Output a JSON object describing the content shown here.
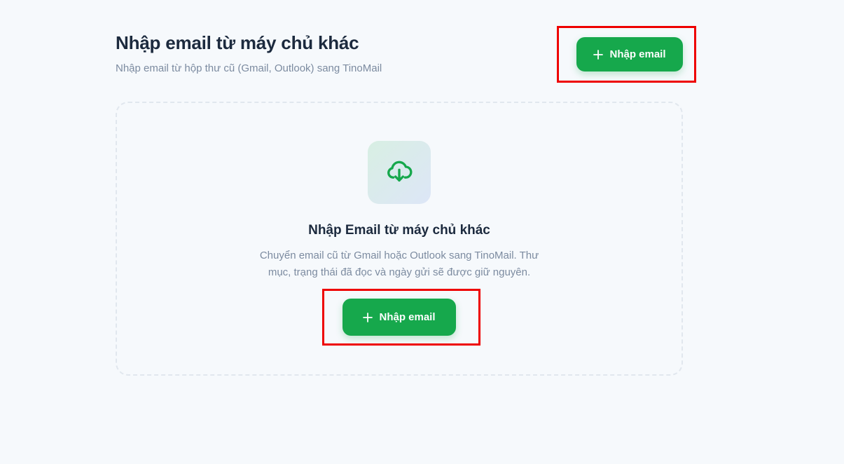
{
  "header": {
    "title": "Nhập email từ máy chủ khác",
    "subtitle": "Nhập email từ hộp thư cũ (Gmail, Outlook) sang TinoMail",
    "import_button_label": "Nhập email"
  },
  "empty_state": {
    "icon": "cloud-download-icon",
    "title": "Nhập Email từ máy chủ khác",
    "description": "Chuyển email cũ từ Gmail hoặc Outlook sang TinoMail. Thư mục, trạng thái đã đọc và ngày gửi sẽ được giữ nguyên.",
    "import_button_label": "Nhập email"
  },
  "colors": {
    "accent": "#16a84c",
    "highlight": "#ee0000",
    "title_text": "#1c2a3e",
    "muted_text": "#7c8ba0",
    "background": "#f6f9fc"
  }
}
